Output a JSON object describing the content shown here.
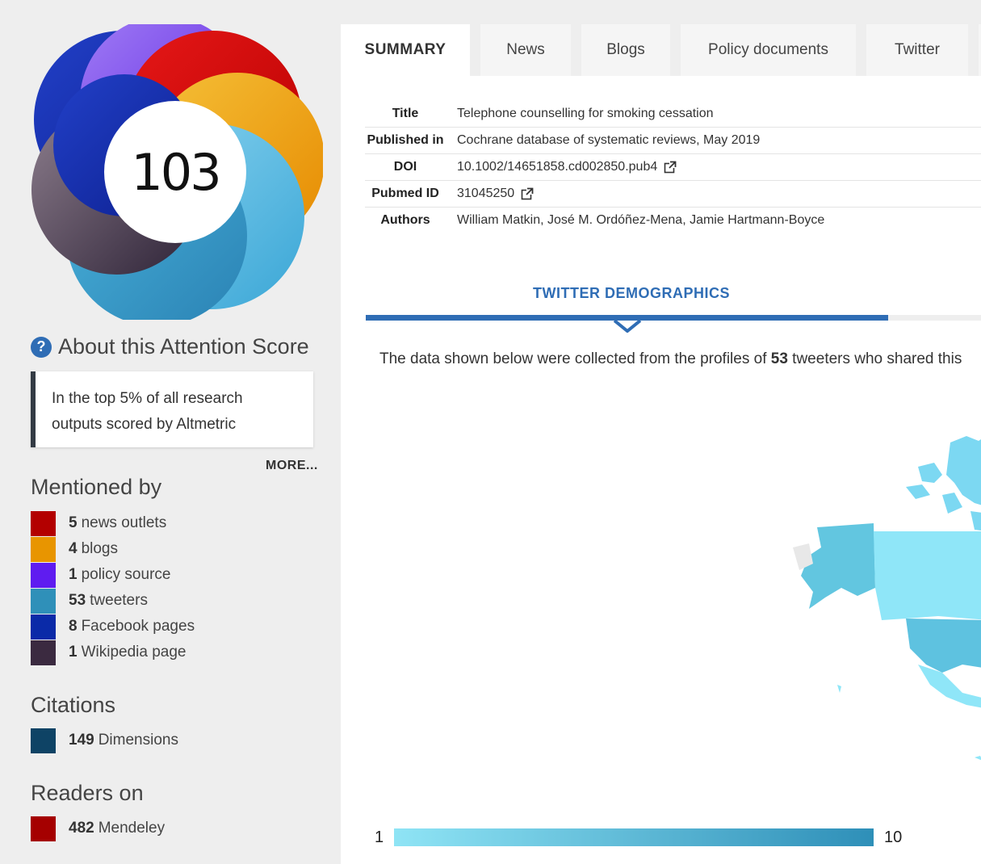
{
  "score": "103",
  "about_title": "About this Attention Score",
  "top_text": "In the top 5% of all research outputs scored by Altmetric",
  "more_label": "MORE...",
  "mentioned_title": "Mentioned by",
  "mentions": [
    {
      "count": "5",
      "label": "news outlets",
      "color": "#b30000"
    },
    {
      "count": "4",
      "label": "blogs",
      "color": "#e89500"
    },
    {
      "count": "1",
      "label": "policy source",
      "color": "#5f1cf0"
    },
    {
      "count": "53",
      "label": "tweeters",
      "color": "#2f90b9"
    },
    {
      "count": "8",
      "label": "Facebook pages",
      "color": "#0a2aa8"
    },
    {
      "count": "1",
      "label": "Wikipedia page",
      "color": "#3b2a40"
    }
  ],
  "citations_title": "Citations",
  "citations": [
    {
      "count": "149",
      "label": "Dimensions",
      "color": "#0e4365"
    }
  ],
  "readers_title": "Readers on",
  "readers": [
    {
      "count": "482",
      "label": "Mendeley",
      "color": "#a50000"
    }
  ],
  "tabs": [
    "SUMMARY",
    "News",
    "Blogs",
    "Policy documents",
    "Twitter"
  ],
  "meta": {
    "title_label": "Title",
    "title_value": "Telephone counselling for smoking cessation",
    "pub_label": "Published in",
    "pub_value": "Cochrane database of systematic reviews, May 2019",
    "doi_label": "DOI",
    "doi_value": "10.1002/14651858.cd002850.pub4",
    "pubmed_label": "Pubmed ID",
    "pubmed_value": "31045250",
    "authors_label": "Authors",
    "authors_value": "William Matkin, José M. Ordóñez-Mena, Jamie Hartmann-Boyce"
  },
  "demographics_title": "TWITTER DEMOGRAPHICS",
  "demographics_text_pre": "The data shown below were collected from the profiles of ",
  "demographics_count": "53",
  "demographics_text_post": " tweeters who shared this",
  "legend_min": "1",
  "legend_max": "10"
}
